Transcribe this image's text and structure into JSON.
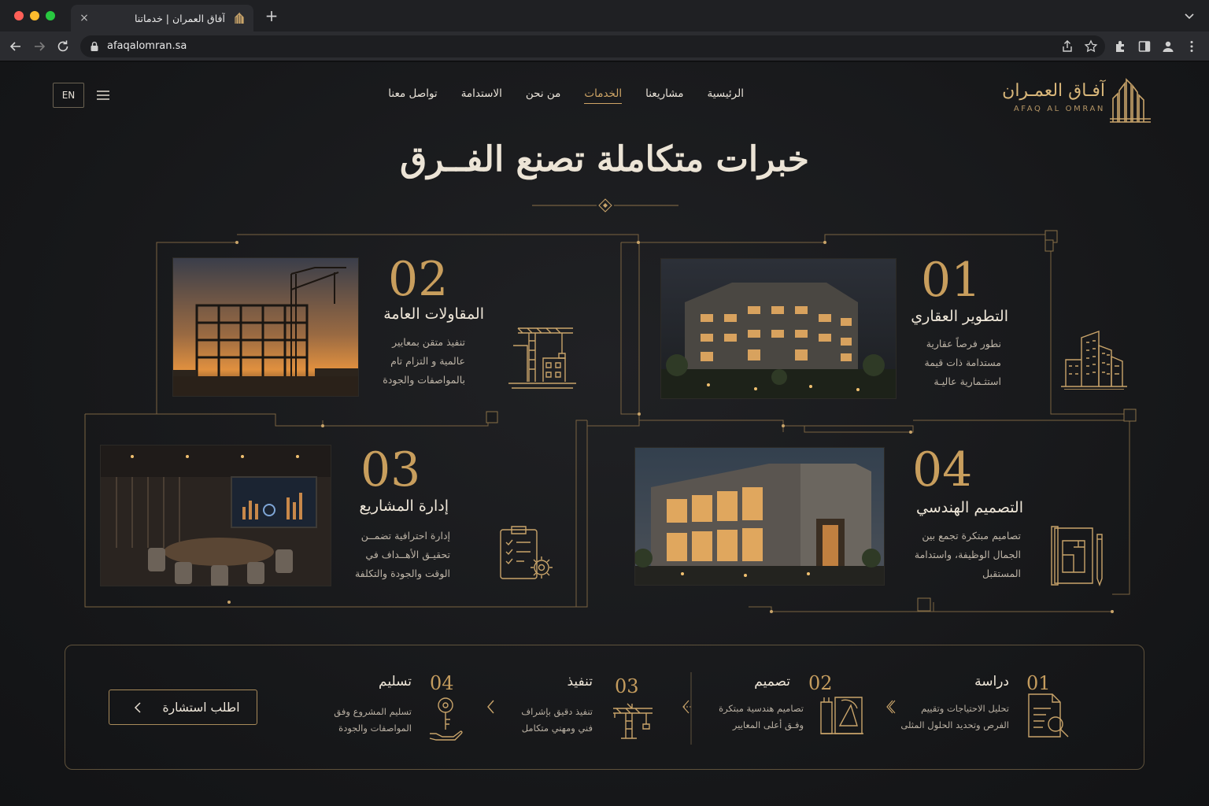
{
  "browser": {
    "tab_title": "آفاق العمران | خدماتنا",
    "tab_close": "×",
    "new_tab": "+",
    "url": "afaqalomran.sa"
  },
  "header": {
    "lang_button": "EN",
    "nav": [
      {
        "label": "الرئيسية",
        "active": false
      },
      {
        "label": "مشاريعنا",
        "active": false
      },
      {
        "label": "الخدمات",
        "active": true
      },
      {
        "label": "من نحن",
        "active": false
      },
      {
        "label": "الاستدامة",
        "active": false
      },
      {
        "label": "تواصل معنا",
        "active": false
      }
    ],
    "brand_ar": "آفـاق العمـران",
    "brand_en": "AFAQ AL OMRAN"
  },
  "hero": {
    "title": "خبرات متكاملة تصنع الفــرق"
  },
  "services": [
    {
      "num": "01",
      "title": "التطوير العقاري",
      "desc": [
        "نطور فرصاً عقارية",
        "مستدامة ذات قيمة",
        "استثـمارية  عاليـة"
      ],
      "icon": "buildings-icon"
    },
    {
      "num": "02",
      "title": "المقاولات العامة",
      "desc": [
        "تنفيذ متقن بمعايير",
        "عالمية و التزام تام",
        "بالمواصفات والجودة"
      ],
      "icon": "crane-icon"
    },
    {
      "num": "03",
      "title": "إدارة المشاريع",
      "desc": [
        "إدارة احترافية تضمــن",
        "تحقيـق الأهــداف في",
        "الوقت والجودة والتكلفة"
      ],
      "icon": "clipboard-gear-icon"
    },
    {
      "num": "04",
      "title": "التصميم الهندسي",
      "desc": [
        "تصاميم مبتكرة تجمع بين",
        "الجمال الوظيفة، واستدامة",
        "المستقبل"
      ],
      "icon": "blueprint-icon"
    }
  ],
  "process": {
    "cta": "اطلب استشارة",
    "steps": [
      {
        "num": "01",
        "title": "دراسة",
        "desc": [
          "تحليل الاحتياجات وتقييم",
          "الفرص وتحديد الحلول المثلى"
        ],
        "icon": "document-search-icon"
      },
      {
        "num": "02",
        "title": "تصميم",
        "desc": [
          "تصاميم هندسية مبتكرة",
          "وفـق أعلى المعايير"
        ],
        "icon": "design-tools-icon"
      },
      {
        "num": "03",
        "title": "تنفيذ",
        "desc": [
          "تنفيذ دقيق بإشراف",
          "فني ومهني متكامل"
        ],
        "icon": "crane-icon"
      },
      {
        "num": "04",
        "title": "تسليم",
        "desc": [
          "تسليم المشروع وفق",
          "المواصفات والجودة"
        ],
        "icon": "key-hand-icon"
      }
    ]
  },
  "colors": {
    "gold": "#c9a46a",
    "background": "#161719",
    "text": "#ece4d6"
  }
}
